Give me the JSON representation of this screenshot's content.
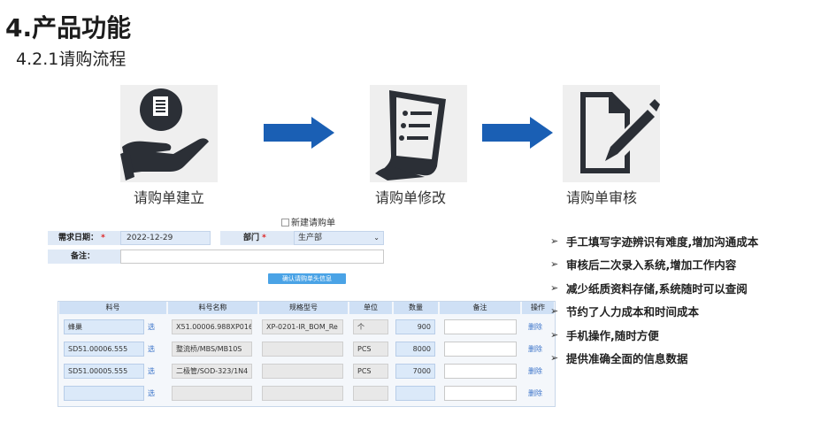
{
  "header": {
    "title": "4.产品功能",
    "subtitle": "4.2.1请购流程"
  },
  "flow": {
    "steps": [
      {
        "label": "请购单建立",
        "icon": "hand-document-icon"
      },
      {
        "label": "请购单修改",
        "icon": "checklist-document-icon"
      },
      {
        "label": "请购单审核",
        "icon": "pen-document-icon"
      }
    ],
    "arrow_color": "#1a5fb4"
  },
  "form": {
    "title": "新建请购单",
    "date_label": "需求日期：",
    "date_value": "2022-12-29",
    "dept_label": "部门",
    "dept_value": "生产部",
    "remark_label": "备注：",
    "required_mark": "*",
    "confirm_button": "确认请购单头信息"
  },
  "table": {
    "columns": [
      "料号",
      "料号名称",
      "规格型号",
      "单位",
      "数量",
      "备注",
      "操作"
    ],
    "select_link": "选",
    "delete_link": "删除",
    "rows": [
      {
        "code": "蜂巢",
        "name": "X51.00006.988XP016",
        "spec": "XP-0201-IR_BOM_Re",
        "unit": "个",
        "qty": "900"
      },
      {
        "code": "SD51.00006.555",
        "name": "整流桥/MBS/MB10S",
        "spec": "",
        "unit": "PCS",
        "qty": "8000"
      },
      {
        "code": "SD51.00005.555",
        "name": "二极管/SOD-323/1N4",
        "spec": "",
        "unit": "PCS",
        "qty": "7000"
      },
      {
        "code": "",
        "name": "",
        "spec": "",
        "unit": "",
        "qty": ""
      }
    ]
  },
  "benefits": [
    "手工填写字迹辨识有难度,增加沟通成本",
    "审核后二次录入系统,增加工作内容",
    "减少纸质资料存储,系统随时可以查阅",
    "节约了人力成本和时间成本",
    "手机操作,随时方便",
    "提供准确全面的信息数据"
  ],
  "bullet_mark": "➢"
}
